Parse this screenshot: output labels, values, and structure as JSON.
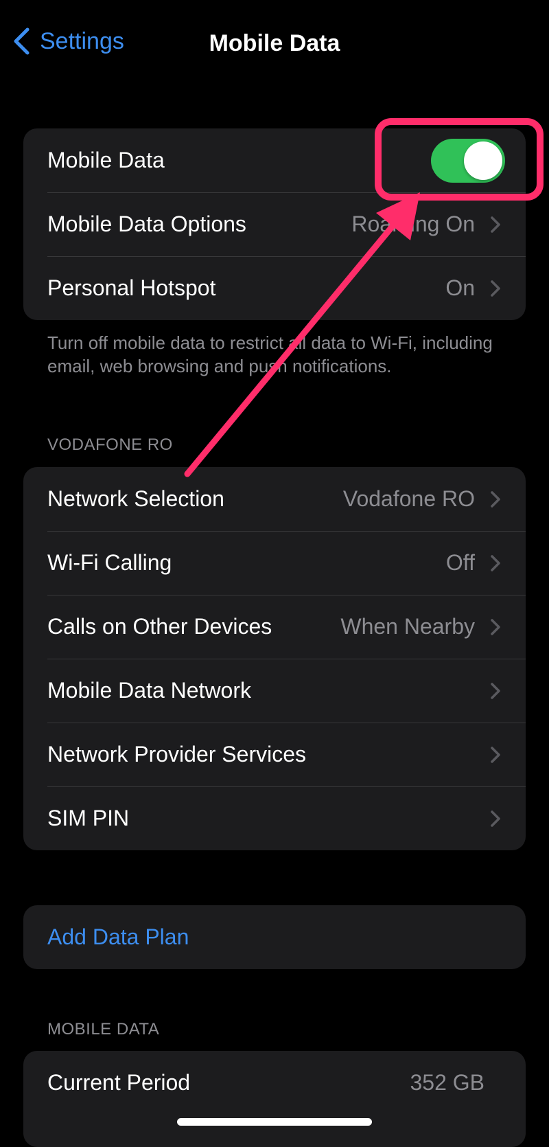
{
  "navbar": {
    "back_label": "Settings",
    "title": "Mobile Data"
  },
  "group_main": {
    "mobile_data": {
      "label": "Mobile Data",
      "toggle_on": true
    },
    "options": {
      "label": "Mobile Data Options",
      "value": "Roaming On"
    },
    "hotspot": {
      "label": "Personal Hotspot",
      "value": "On"
    }
  },
  "footnote": "Turn off mobile data to restrict all data to Wi-Fi, including email, web browsing and push notifications.",
  "carrier_section": {
    "header": "VODAFONE RO",
    "rows": [
      {
        "label": "Network Selection",
        "value": "Vodafone RO"
      },
      {
        "label": "Wi-Fi Calling",
        "value": "Off"
      },
      {
        "label": "Calls on Other Devices",
        "value": "When Nearby"
      },
      {
        "label": "Mobile Data Network",
        "value": ""
      },
      {
        "label": "Network Provider Services",
        "value": ""
      },
      {
        "label": "SIM PIN",
        "value": ""
      }
    ]
  },
  "add_plan": {
    "label": "Add Data Plan"
  },
  "usage_section": {
    "header": "MOBILE DATA",
    "current_period": {
      "label": "Current Period",
      "value": "352 GB"
    }
  },
  "colors": {
    "accent_blue": "#3d8ef0",
    "toggle_green": "#30c158",
    "annotation_pink": "#ff2d6a",
    "cell_background": "#1c1c1e"
  },
  "icons": [
    "chevron-left-icon",
    "chevron-right-icon"
  ]
}
